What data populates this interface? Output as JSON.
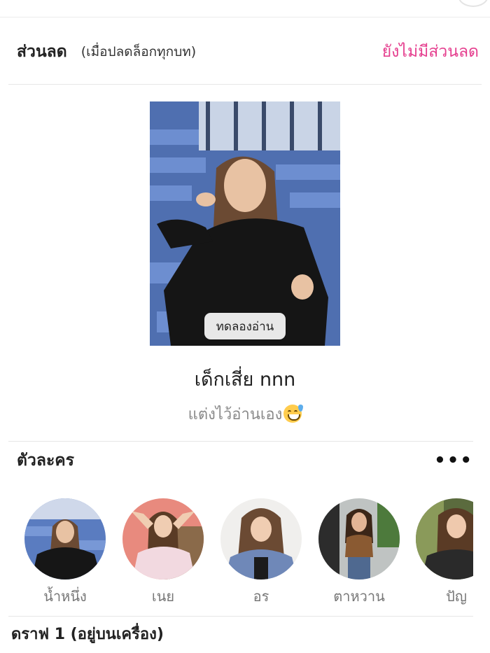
{
  "discount": {
    "title": "ส่วนลด",
    "note": "(เมื่อปลดล็อกทุกบท)",
    "status": "ยังไม่มีส่วนลด"
  },
  "story": {
    "preview_label": "ทดลองอ่าน",
    "title": "เด็กเสี่ย nnn",
    "subtitle": "แต่งไว้อ่านเอง",
    "subtitle_emoji": "grinning-sweat-emoji"
  },
  "characters": {
    "title": "ตัวละคร",
    "more_icon": "more-horizontal-icon",
    "items": [
      {
        "name": "น้ำหนึ่ง"
      },
      {
        "name": "เนย"
      },
      {
        "name": "อร"
      },
      {
        "name": "ตาหวาน"
      },
      {
        "name": "ปัญ"
      }
    ]
  },
  "draft": {
    "label": "ดราฟ 1 (อยู่บนเครื่อง)"
  },
  "colors": {
    "accent": "#e53e8e",
    "text": "#222222",
    "muted": "#8a8a8a"
  }
}
